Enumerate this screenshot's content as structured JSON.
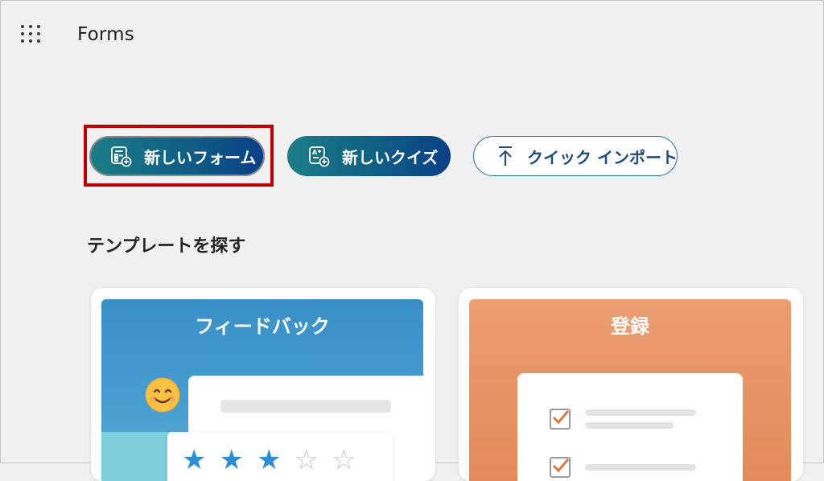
{
  "header": {
    "app_title": "Forms",
    "app_launcher_icon": "waffle-grid-icon"
  },
  "actions": {
    "new_form": {
      "label": "新しいフォーム",
      "icon": "form-add-icon"
    },
    "new_quiz": {
      "label": "新しいクイズ",
      "icon": "quiz-add-icon"
    },
    "quick_import": {
      "label": "クイック インポート",
      "icon": "upload-arrow-icon"
    }
  },
  "highlight_color": "#c00000",
  "templates": {
    "section_title": "テンプレートを探す",
    "items": [
      {
        "label": "フィードバック",
        "color": "#3a8fc6",
        "rating_filled": 3,
        "rating_total": 5
      },
      {
        "label": "登録",
        "color": "#e28a58"
      }
    ]
  }
}
